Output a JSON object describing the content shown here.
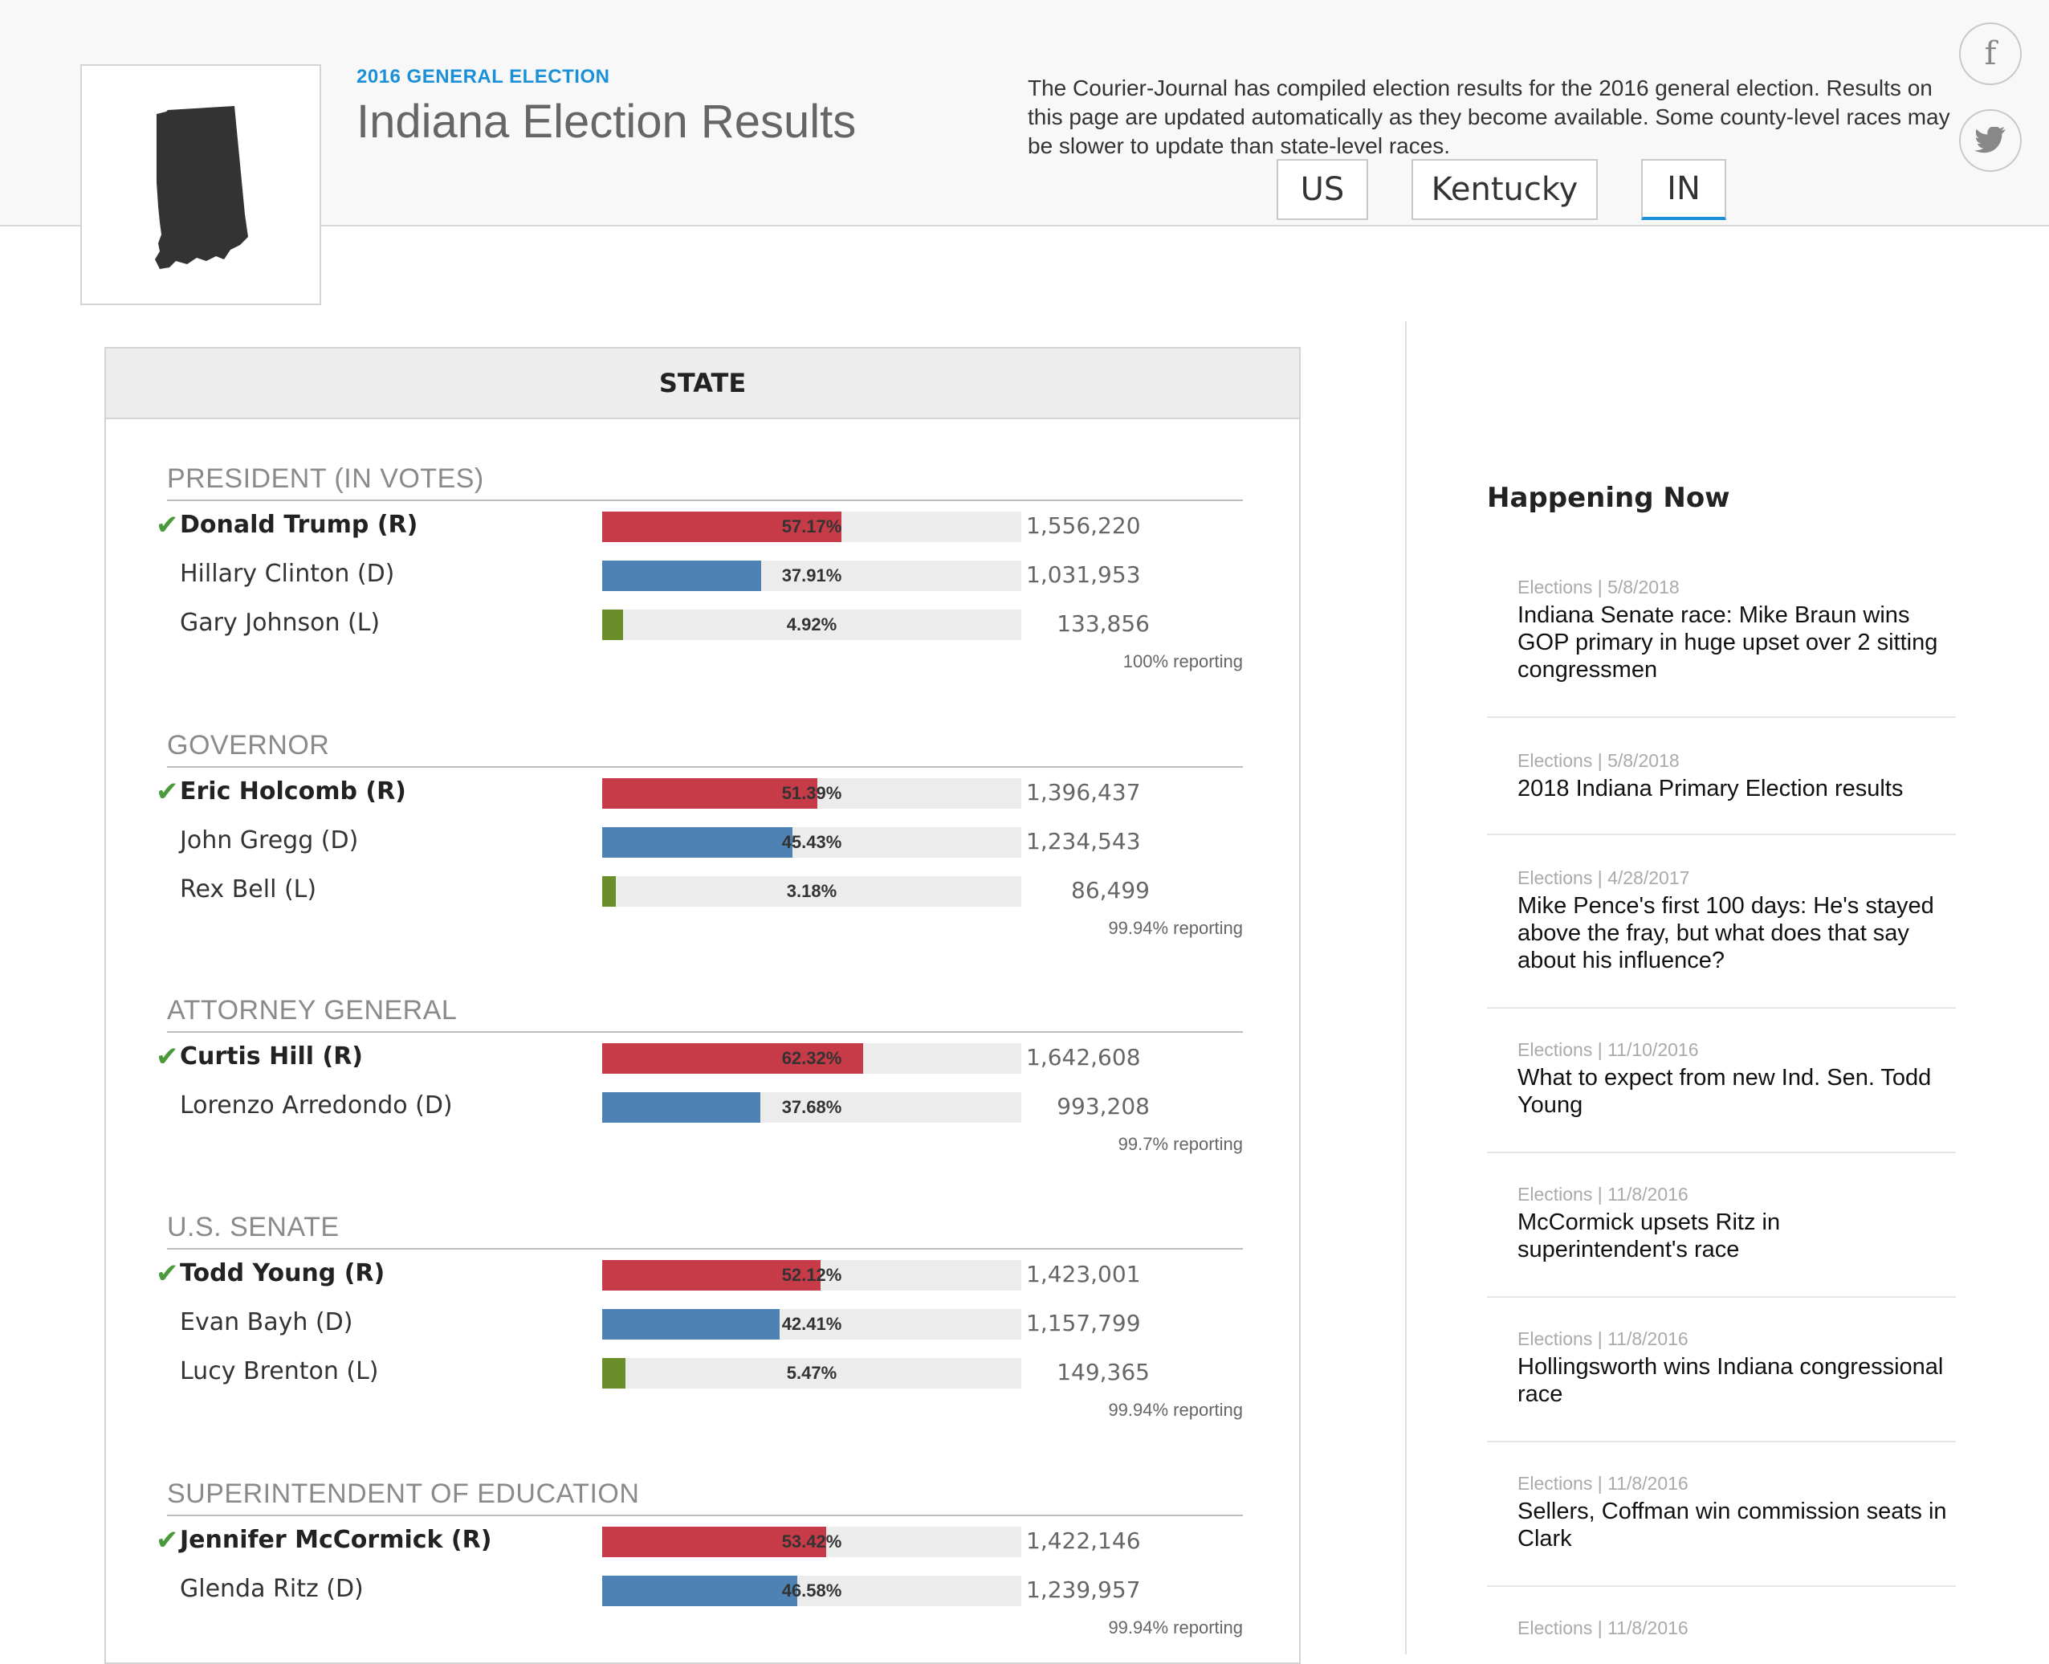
{
  "header": {
    "kicker": "2016 GENERAL ELECTION",
    "title": "Indiana Election Results",
    "intro": "The Courier-Journal has compiled election results for the 2016 general election. Results on this page are updated automatically as they become available. Some county-level races may be slower to update than state-level races.",
    "tabs": [
      {
        "label": "US",
        "active": false
      },
      {
        "label": "Kentucky",
        "active": false
      },
      {
        "label": "IN",
        "active": true
      }
    ],
    "social": [
      "facebook-icon",
      "twitter-icon"
    ]
  },
  "colors": {
    "republican": "#c63b47",
    "democrat": "#4e82b4",
    "libertarian": "#6a8f2a",
    "accent": "#1a90d8",
    "winner_check": "#4a9a3c"
  },
  "results": {
    "panel_title": "STATE",
    "races": [
      {
        "title": "PRESIDENT (IN VOTES)",
        "reporting": "100% reporting",
        "candidates": [
          {
            "name": "Donald Trump (R)",
            "winner": true,
            "party": "R",
            "pct": "57.17%",
            "share": 57.17,
            "votes": "1,556,220"
          },
          {
            "name": "Hillary Clinton (D)",
            "winner": false,
            "party": "D",
            "pct": "37.91%",
            "share": 37.91,
            "votes": "1,031,953"
          },
          {
            "name": "Gary Johnson (L)",
            "winner": false,
            "party": "L",
            "pct": "4.92%",
            "share": 4.92,
            "votes": "133,856"
          }
        ]
      },
      {
        "title": "GOVERNOR",
        "reporting": "99.94% reporting",
        "candidates": [
          {
            "name": "Eric Holcomb (R)",
            "winner": true,
            "party": "R",
            "pct": "51.39%",
            "share": 51.39,
            "votes": "1,396,437"
          },
          {
            "name": "John Gregg (D)",
            "winner": false,
            "party": "D",
            "pct": "45.43%",
            "share": 45.43,
            "votes": "1,234,543"
          },
          {
            "name": "Rex Bell (L)",
            "winner": false,
            "party": "L",
            "pct": "3.18%",
            "share": 3.18,
            "votes": "86,499"
          }
        ]
      },
      {
        "title": "ATTORNEY GENERAL",
        "reporting": "99.7% reporting",
        "candidates": [
          {
            "name": "Curtis Hill (R)",
            "winner": true,
            "party": "R",
            "pct": "62.32%",
            "share": 62.32,
            "votes": "1,642,608"
          },
          {
            "name": "Lorenzo Arredondo (D)",
            "winner": false,
            "party": "D",
            "pct": "37.68%",
            "share": 37.68,
            "votes": "993,208"
          }
        ]
      },
      {
        "title": "U.S. SENATE",
        "reporting": "99.94% reporting",
        "candidates": [
          {
            "name": "Todd Young (R)",
            "winner": true,
            "party": "R",
            "pct": "52.12%",
            "share": 52.12,
            "votes": "1,423,001"
          },
          {
            "name": "Evan Bayh (D)",
            "winner": false,
            "party": "D",
            "pct": "42.41%",
            "share": 42.41,
            "votes": "1,157,799"
          },
          {
            "name": "Lucy Brenton (L)",
            "winner": false,
            "party": "L",
            "pct": "5.47%",
            "share": 5.47,
            "votes": "149,365"
          }
        ]
      },
      {
        "title": "SUPERINTENDENT OF EDUCATION",
        "reporting": "99.94% reporting",
        "candidates": [
          {
            "name": "Jennifer McCormick (R)",
            "winner": true,
            "party": "R",
            "pct": "53.42%",
            "share": 53.42,
            "votes": "1,422,146"
          },
          {
            "name": "Glenda Ritz (D)",
            "winner": false,
            "party": "D",
            "pct": "46.58%",
            "share": 46.58,
            "votes": "1,239,957"
          }
        ]
      }
    ]
  },
  "happening_now": {
    "title": "Happening Now",
    "items": [
      {
        "meta": "Elections | 5/8/2018",
        "headline": "Indiana Senate race: Mike Braun wins GOP primary in huge upset over 2 sitting congressmen"
      },
      {
        "meta": "Elections | 5/8/2018",
        "headline": "2018 Indiana Primary Election results"
      },
      {
        "meta": "Elections | 4/28/2017",
        "headline": "Mike Pence's first 100 days: He's stayed above the fray, but what does that say about his influence?"
      },
      {
        "meta": "Elections | 11/10/2016",
        "headline": "What to expect from new Ind. Sen. Todd Young"
      },
      {
        "meta": "Elections | 11/8/2016",
        "headline": "McCormick upsets Ritz in superintendent's race"
      },
      {
        "meta": "Elections | 11/8/2016",
        "headline": "Hollingsworth wins Indiana congressional race"
      },
      {
        "meta": "Elections | 11/8/2016",
        "headline": "Sellers, Coffman win commission seats in Clark"
      },
      {
        "meta": "Elections | 11/8/2016",
        "headline": ""
      }
    ]
  }
}
